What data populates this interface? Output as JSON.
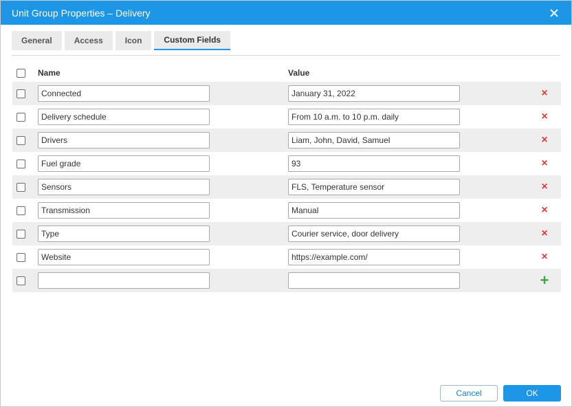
{
  "dialog": {
    "title": "Unit Group Properties – Delivery",
    "close_icon": "close-icon"
  },
  "tabs": [
    {
      "label": "General",
      "active": false
    },
    {
      "label": "Access",
      "active": false
    },
    {
      "label": "Icon",
      "active": false
    },
    {
      "label": "Custom Fields",
      "active": true
    }
  ],
  "table": {
    "headers": {
      "name": "Name",
      "value": "Value"
    },
    "rows": [
      {
        "name": "Connected",
        "value": "January 31, 2022"
      },
      {
        "name": "Delivery schedule",
        "value": "From 10 a.m. to 10 p.m. daily"
      },
      {
        "name": "Drivers",
        "value": "Liam, John, David, Samuel"
      },
      {
        "name": "Fuel grade",
        "value": "93"
      },
      {
        "name": "Sensors",
        "value": "FLS, Temperature sensor"
      },
      {
        "name": "Transmission",
        "value": "Manual"
      },
      {
        "name": "Type",
        "value": "Courier service, door delivery"
      },
      {
        "name": "Website",
        "value": "https://example.com/"
      }
    ],
    "new_row": {
      "name": "",
      "value": ""
    },
    "delete_icon": "×",
    "add_icon": "+"
  },
  "buttons": {
    "cancel": "Cancel",
    "ok": "OK"
  },
  "colors": {
    "accent": "#1d96e8",
    "delete": "#e33a3a",
    "add": "#3aa845"
  }
}
